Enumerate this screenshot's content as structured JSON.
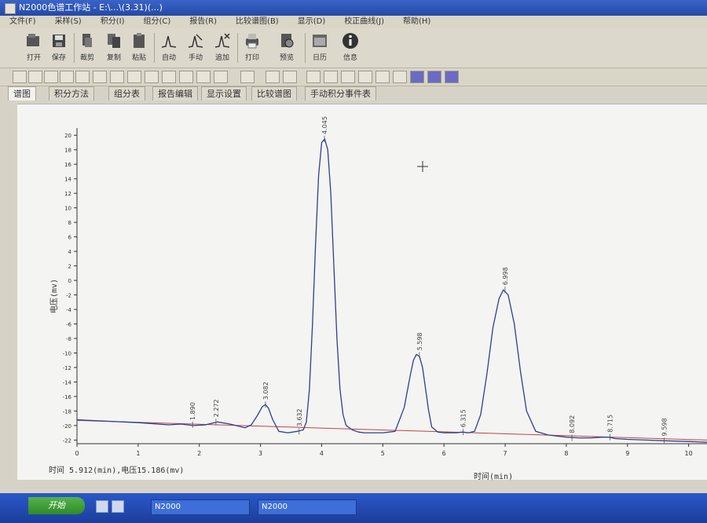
{
  "window": {
    "title": "N2000色谱工作站 - E:\\...\\(3.31)(...)"
  },
  "menu": {
    "items": [
      "文件(F)",
      "采样(S)",
      "积分(I)",
      "组分(C)",
      "报告(R)",
      "比较谱图(B)",
      "显示(D)",
      "校正曲线(J)",
      "帮助(H)"
    ]
  },
  "toolbar": {
    "buttons": [
      {
        "label": "打开",
        "icon": "open-icon"
      },
      {
        "label": "保存",
        "icon": "save-icon"
      },
      {
        "label": "裁剪",
        "icon": "cut-icon"
      },
      {
        "label": "复制",
        "icon": "copy-icon"
      },
      {
        "label": "粘贴",
        "icon": "paste-icon"
      },
      {
        "label": "自动",
        "icon": "auto-integrate-icon"
      },
      {
        "label": "手动",
        "icon": "manual-integrate-icon"
      },
      {
        "label": "追加",
        "icon": "append-icon"
      },
      {
        "label": "打印",
        "icon": "print-icon"
      },
      {
        "label": "预览",
        "icon": "preview-icon"
      },
      {
        "label": "日历",
        "icon": "calendar-icon"
      },
      {
        "label": "信息",
        "icon": "info-icon"
      }
    ]
  },
  "tabs": [
    "谱图",
    "积分方法",
    "组分表",
    "报告编辑",
    "显示设置",
    "比较谱图",
    "手动积分事件表"
  ],
  "status": {
    "readout": "时间 5.912(min),电压15.186(mv)"
  },
  "taskbar": {
    "start_label": "开始",
    "tasks": [
      "N2000",
      "N2000"
    ]
  },
  "chart_data": {
    "type": "line",
    "title": "",
    "xlabel": "时间(min)",
    "ylabel": "电压(mv)",
    "xlim": [
      0,
      10.3
    ],
    "ylim": [
      -22.5,
      21
    ],
    "x_ticks": [
      0,
      1,
      2,
      3,
      4,
      5,
      6,
      7,
      8,
      9,
      10
    ],
    "y_ticks": [
      20,
      18,
      16,
      14,
      12,
      10,
      8,
      6,
      4,
      2,
      0,
      -2,
      -4,
      -6,
      -8,
      -10,
      -12,
      -14,
      -16,
      -18,
      -20,
      -22
    ],
    "series": [
      {
        "name": "",
        "color": "#2d3f95",
        "x": [
          0.0,
          0.5,
          1.0,
          1.5,
          1.7,
          1.9,
          2.1,
          2.3,
          2.5,
          2.75,
          2.85,
          2.95,
          3.03,
          3.08,
          3.13,
          3.2,
          3.3,
          3.45,
          3.6,
          3.7,
          3.75,
          3.8,
          3.85,
          3.9,
          3.95,
          4.0,
          4.05,
          4.1,
          4.15,
          4.2,
          4.25,
          4.3,
          4.35,
          4.4,
          4.5,
          4.6,
          4.7,
          4.8,
          5.0,
          5.2,
          5.35,
          5.45,
          5.5,
          5.55,
          5.6,
          5.65,
          5.7,
          5.75,
          5.8,
          5.9,
          6.0,
          6.1,
          6.2,
          6.3,
          6.4,
          6.5,
          6.6,
          6.7,
          6.8,
          6.9,
          6.97,
          7.05,
          7.15,
          7.25,
          7.35,
          7.5,
          7.7,
          8.0,
          8.2,
          8.4,
          8.6,
          8.7,
          8.8,
          9.0,
          9.3,
          9.6,
          10.0,
          10.3
        ],
        "y": [
          -19.2,
          -19.4,
          -19.6,
          -19.9,
          -19.8,
          -20.0,
          -19.9,
          -19.5,
          -19.8,
          -20.3,
          -19.9,
          -18.6,
          -17.4,
          -17.1,
          -17.6,
          -19.2,
          -20.8,
          -21.0,
          -20.8,
          -20.6,
          -19.5,
          -15.0,
          -6.0,
          5.0,
          14.5,
          19.0,
          19.5,
          18.0,
          12.0,
          2.0,
          -8.0,
          -15.0,
          -18.5,
          -20.0,
          -20.6,
          -20.9,
          -21.0,
          -21.0,
          -21.0,
          -20.8,
          -17.5,
          -13.0,
          -11.0,
          -10.2,
          -10.5,
          -12.0,
          -15.0,
          -18.0,
          -20.2,
          -20.9,
          -21.0,
          -21.0,
          -21.0,
          -20.9,
          -21.0,
          -20.8,
          -18.5,
          -13.0,
          -6.5,
          -2.5,
          -1.3,
          -2.0,
          -6.0,
          -12.5,
          -18.0,
          -20.8,
          -21.3,
          -21.6,
          -21.7,
          -21.7,
          -21.6,
          -21.6,
          -21.8,
          -21.9,
          -22.0,
          -22.1,
          -22.2,
          -22.3
        ]
      }
    ],
    "baseline": {
      "color": "#c0453e",
      "x": [
        0.0,
        10.3
      ],
      "y": [
        -19.3,
        -22.0
      ]
    },
    "peak_labels": [
      {
        "label": "1.890",
        "x": 1.89,
        "y": -19.9
      },
      {
        "label": "2.272",
        "x": 2.272,
        "y": -19.5
      },
      {
        "label": "3.082",
        "x": 3.082,
        "y": -17.1
      },
      {
        "label": "3.632",
        "x": 3.632,
        "y": -20.8
      },
      {
        "label": "4.045",
        "x": 4.045,
        "y": 19.5
      },
      {
        "label": "5.598",
        "x": 5.598,
        "y": -10.3
      },
      {
        "label": "6.315",
        "x": 6.315,
        "y": -20.9
      },
      {
        "label": "6.998",
        "x": 6.998,
        "y": -1.3
      },
      {
        "label": "8.092",
        "x": 8.092,
        "y": -21.7
      },
      {
        "label": "8.715",
        "x": 8.715,
        "y": -21.6
      },
      {
        "label": "9.598",
        "x": 9.598,
        "y": -22.1
      }
    ]
  }
}
